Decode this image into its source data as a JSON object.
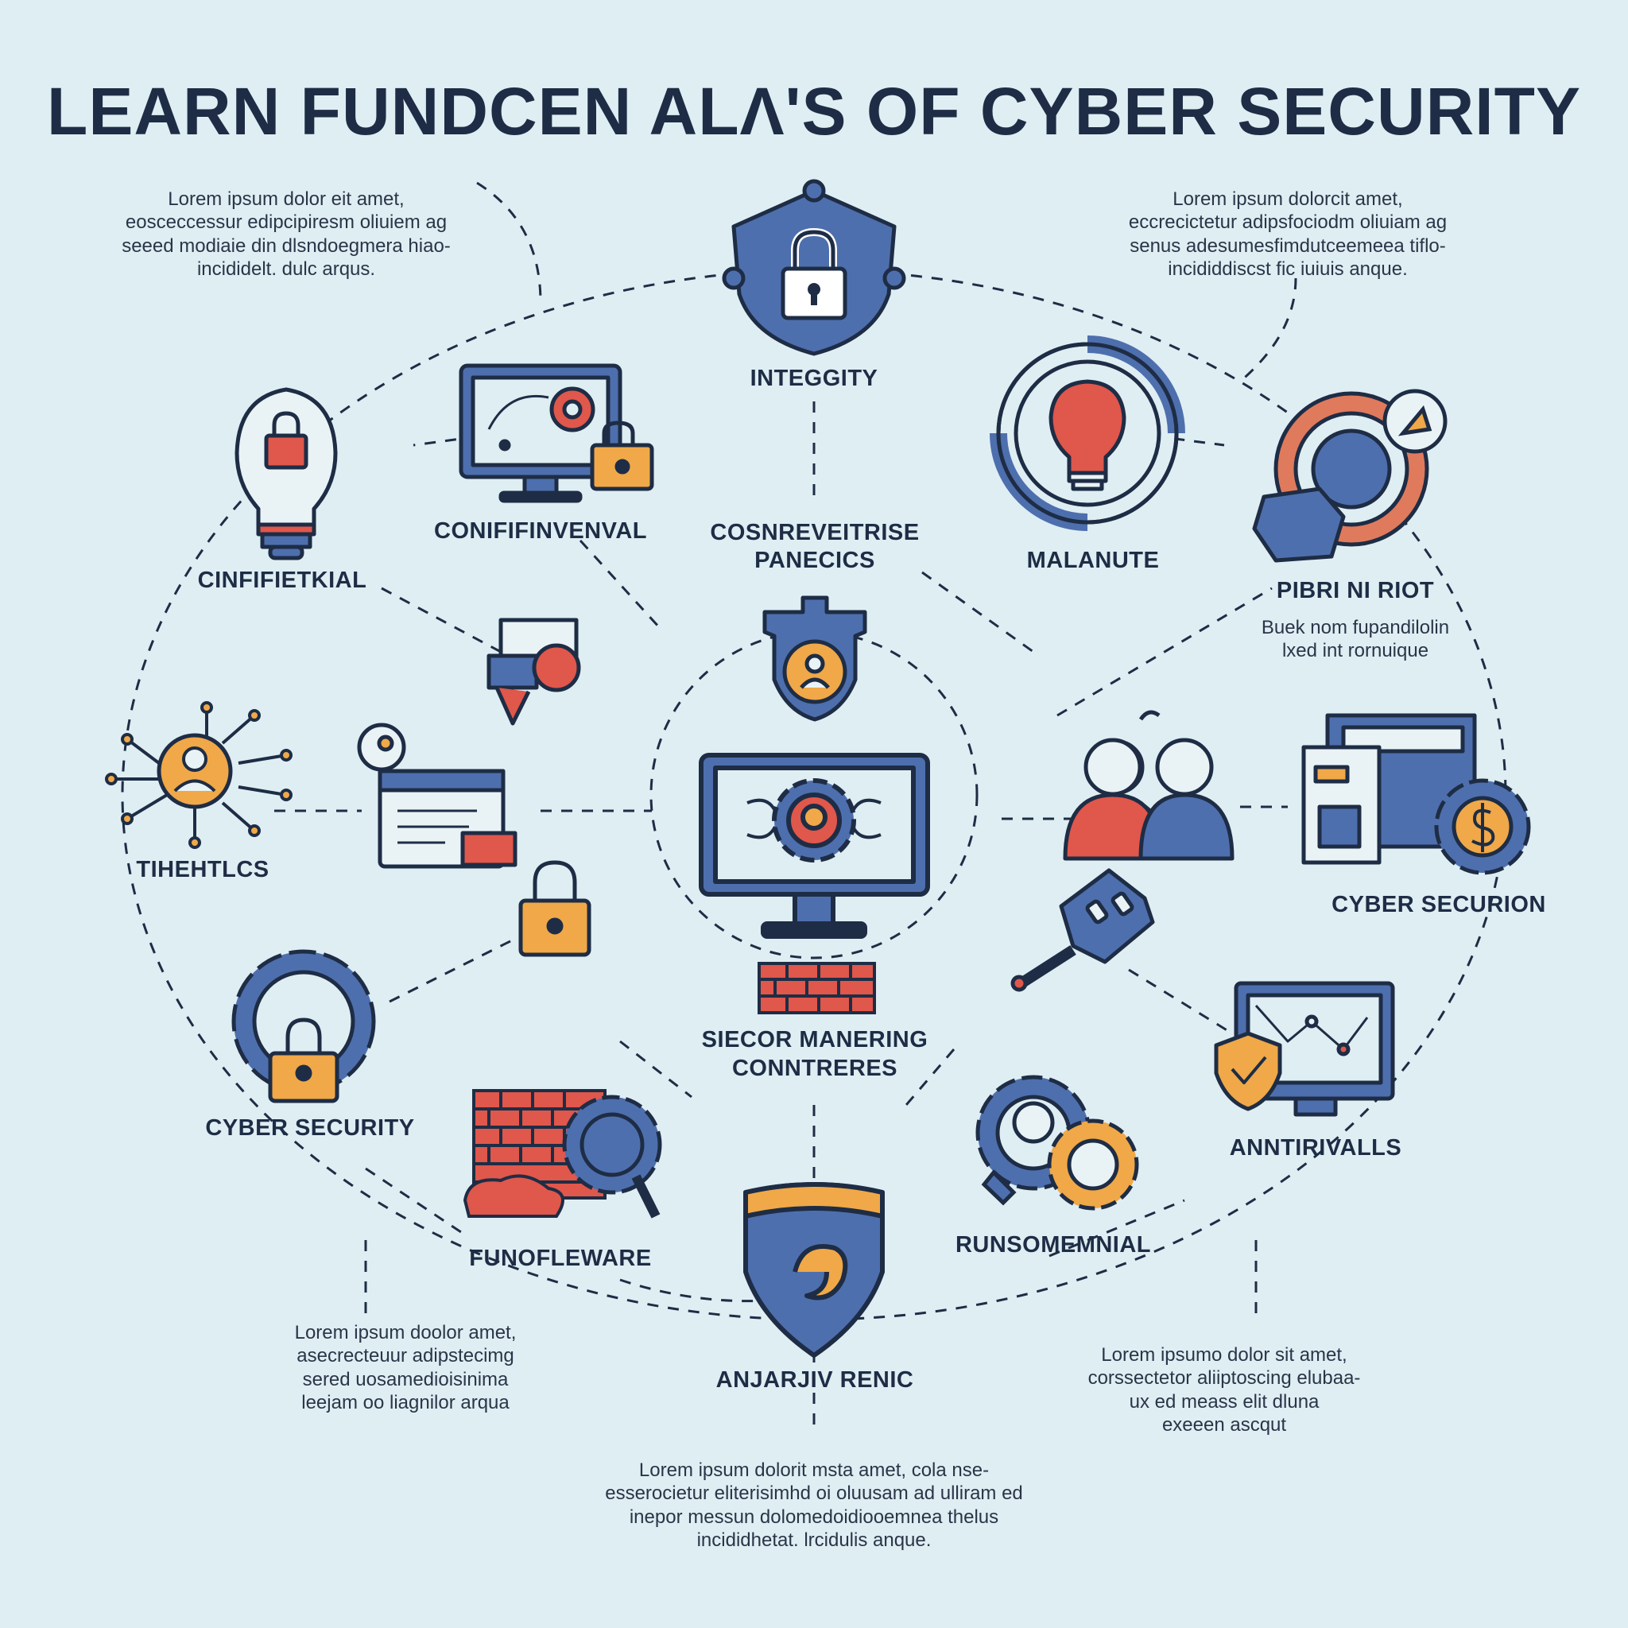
{
  "title": "LEARN FUNDCEN ALɅ'S OF  CYBER SECURITY",
  "colors": {
    "background": "#dfeef3",
    "navy": "#1e2d45",
    "blue": "#4e6fae",
    "orange": "#f0a848",
    "red": "#e0574b",
    "line": "#1e2d45"
  },
  "labels": {
    "integrity": "INTEGGITY",
    "confifinvenval": "CONIFIFINVENVAL",
    "coserveterise_1": "COSNREVEITRISE",
    "coserveterise_2": "PANECICS",
    "malanute": "MALANUTE",
    "pibrni_riot": "PIBRI NI RIOT",
    "cinfifietkial": "CINFIFIETKIAL",
    "thiehtlcs": "TIHEHTLCS",
    "cyber_securion": "CYBER SECURION",
    "center_1": "SIECOR MANERING",
    "center_2": "CONNTRERES",
    "cyber_security": "CYBER SECURITY",
    "antirivalls": "ANNTIRIVALLS",
    "funofleware": "FUNOFLEWARE",
    "runsomemnial": "RUNSOMEMNIAL",
    "anjarjiv_renic": "ANJARJIV RENIC"
  },
  "notes": {
    "top_left": [
      "Lorem ipsum dolor eit amet,",
      "eosceccessur edipcipiresm oliuiem ag",
      "seeed modiaie din dlsndoegmera hiao-",
      "incididelt. dulc arqus."
    ],
    "top_right": [
      "Lorem ipsum dolorcit amet,",
      "eccrecictetur adipsfociodm oliuiam ag",
      "senus adesumesfimdutceemeea tiflo-",
      "incididdiscst fic iuiuis anque."
    ],
    "pibrni": [
      "Buek nom fupandilolin",
      "lxed int rornuique"
    ],
    "bottom_left": [
      "Lorem ipsum doolor amet,",
      "asecrecteuur adipstecimg",
      "sered uosamedioisinima",
      "leejam oo liagnilor arqua"
    ],
    "bottom_right": [
      "Lorem ipsumo dolor sit amet,",
      "corssectetor aliiptoscing elubaa-",
      "ux ed meass elit dluna",
      "exeeen ascqut"
    ],
    "bottom_center": [
      "Lorem ipsum dolorit msta amet, cola nse-",
      "esserocietur eliterisimhd oi oluusam ad ulliram ed",
      "inepor messun dolomedoidiooemnea thelus",
      "incididhetat. lrcidulis anque."
    ]
  }
}
